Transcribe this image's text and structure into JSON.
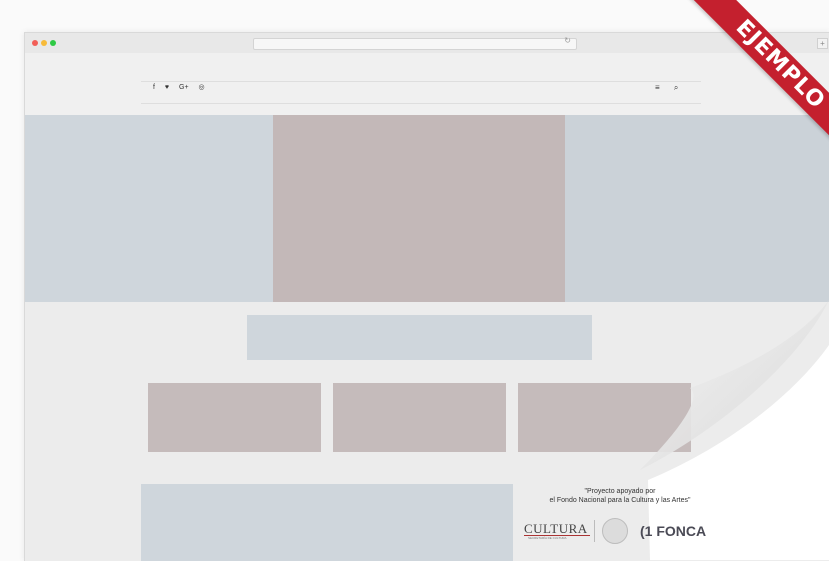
{
  "browser": {
    "reload_glyph": "↻",
    "new_tab_glyph": "+"
  },
  "navbar": {
    "social_icons": [
      "f",
      "♥",
      "G+",
      "◎"
    ],
    "menu_glyph": "≡",
    "search_glyph": "⌕"
  },
  "ribbon": {
    "label": "EJEMPLO",
    "color": "#c4202e"
  },
  "credit": {
    "line1": "\"Proyecto apoyado por",
    "line2": "el Fondo Nacional para la Cultura y las Artes\""
  },
  "logos": {
    "cultura": "CULTURA",
    "cultura_sub": "SECRETARÍA DE CULTURA",
    "fonca": "FONCA",
    "fonca_mark": "(1"
  }
}
